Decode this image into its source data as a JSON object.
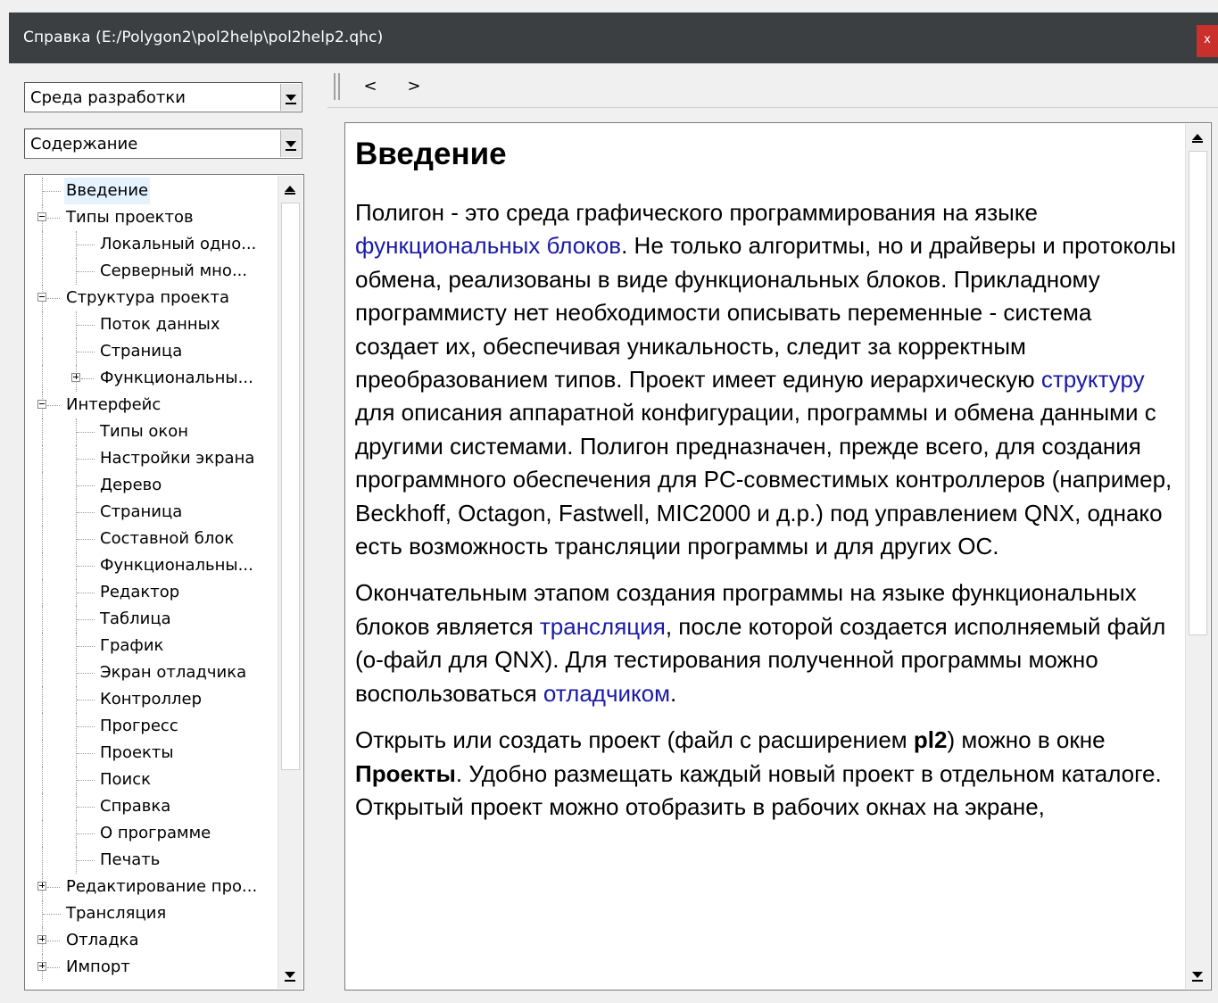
{
  "window": {
    "title": "Справка (E:/Polygon2\\pol2help\\pol2help2.qhc)",
    "close_label": "x"
  },
  "sidebar": {
    "env_combo": {
      "value": "Среда разработки"
    },
    "view_combo": {
      "value": "Содержание"
    },
    "tree": [
      {
        "label": "Введение",
        "level": 0,
        "expander": "none",
        "selected": true
      },
      {
        "label": "Типы проектов",
        "level": 0,
        "expander": "minus"
      },
      {
        "label": "Локальный одно...",
        "level": 1,
        "expander": "none"
      },
      {
        "label": "Серверный мно...",
        "level": 1,
        "expander": "none"
      },
      {
        "label": "Структура проекта",
        "level": 0,
        "expander": "minus"
      },
      {
        "label": "Поток данных",
        "level": 1,
        "expander": "none"
      },
      {
        "label": "Страница",
        "level": 1,
        "expander": "none"
      },
      {
        "label": "Функциональны...",
        "level": 1,
        "expander": "plus"
      },
      {
        "label": "Интерфейс",
        "level": 0,
        "expander": "minus"
      },
      {
        "label": "Типы окон",
        "level": 1,
        "expander": "none"
      },
      {
        "label": "Настройки экрана",
        "level": 1,
        "expander": "none"
      },
      {
        "label": "Дерево",
        "level": 1,
        "expander": "none"
      },
      {
        "label": "Страница",
        "level": 1,
        "expander": "none"
      },
      {
        "label": "Составной блок",
        "level": 1,
        "expander": "none"
      },
      {
        "label": "Функциональны...",
        "level": 1,
        "expander": "none"
      },
      {
        "label": "Редактор",
        "level": 1,
        "expander": "none"
      },
      {
        "label": "Таблица",
        "level": 1,
        "expander": "none"
      },
      {
        "label": "График",
        "level": 1,
        "expander": "none"
      },
      {
        "label": "Экран отладчика",
        "level": 1,
        "expander": "none"
      },
      {
        "label": "Контроллер",
        "level": 1,
        "expander": "none"
      },
      {
        "label": "Прогресс",
        "level": 1,
        "expander": "none"
      },
      {
        "label": "Проекты",
        "level": 1,
        "expander": "none"
      },
      {
        "label": "Поиск",
        "level": 1,
        "expander": "none"
      },
      {
        "label": "Справка",
        "level": 1,
        "expander": "none"
      },
      {
        "label": "О программе",
        "level": 1,
        "expander": "none"
      },
      {
        "label": "Печать",
        "level": 1,
        "expander": "none"
      },
      {
        "label": "Редактирование про...",
        "level": 0,
        "expander": "plus"
      },
      {
        "label": "Трансляция",
        "level": 0,
        "expander": "none"
      },
      {
        "label": "Отладка",
        "level": 0,
        "expander": "plus"
      },
      {
        "label": "Импорт",
        "level": 0,
        "expander": "plus"
      }
    ],
    "tree_scroll_fraction": 0.0
  },
  "toolbar": {
    "back_label": "<",
    "forward_label": ">"
  },
  "content": {
    "heading": "Введение",
    "paragraphs": [
      [
        {
          "t": "Полигон - это среда графического программирования на языке "
        },
        {
          "t": "функциональных блоков",
          "link": true
        },
        {
          "t": ". Не только алгоритмы, но и драйверы и протоколы обмена, реализованы в виде функциональных блоков. Прикладному программисту нет необходимости описывать переменные - система создает их, обеспечивая уникальность, следит за корректным преобразованием типов. Проект имеет единую иерархическую "
        },
        {
          "t": "структуру",
          "link": true
        },
        {
          "t": " для описания аппаратной конфигурации, программы и обмена данными с другими системами. Полигон предназначен, прежде всего, для создания программного обеспечения для PC-совместимых контроллеров (например, Beckhoff, Octagon, Fastwell, MIC2000 и д.р.) под управлением QNX, однако есть возможность трансляции программы и для других ОС."
        }
      ],
      [
        {
          "t": "Окончательным этапом создания программы на языке функциональных блоков является "
        },
        {
          "t": "трансляция",
          "link": true
        },
        {
          "t": ", после которой создается исполняемый файл (о-файл для QNX). Для тестирования полученной программы можно воспользоваться "
        },
        {
          "t": "отладчиком",
          "link": true
        },
        {
          "t": "."
        }
      ],
      [
        {
          "t": "Открыть или создать проект (файл с расширением "
        },
        {
          "t": "pl2",
          "bold": true
        },
        {
          "t": ") можно в окне "
        },
        {
          "t": "Проекты",
          "bold": true
        },
        {
          "t": ". Удобно размещать каждый новый проект в отдельном каталоге."
        }
      ],
      [
        {
          "t": "Открытый проект можно отобразить в рабочих окнах на экране,"
        }
      ]
    ],
    "scroll_fraction": 0.0
  },
  "colors": {
    "titlebar": "#3c3f41",
    "link": "#1a1aa6",
    "close": "#c9302c"
  }
}
